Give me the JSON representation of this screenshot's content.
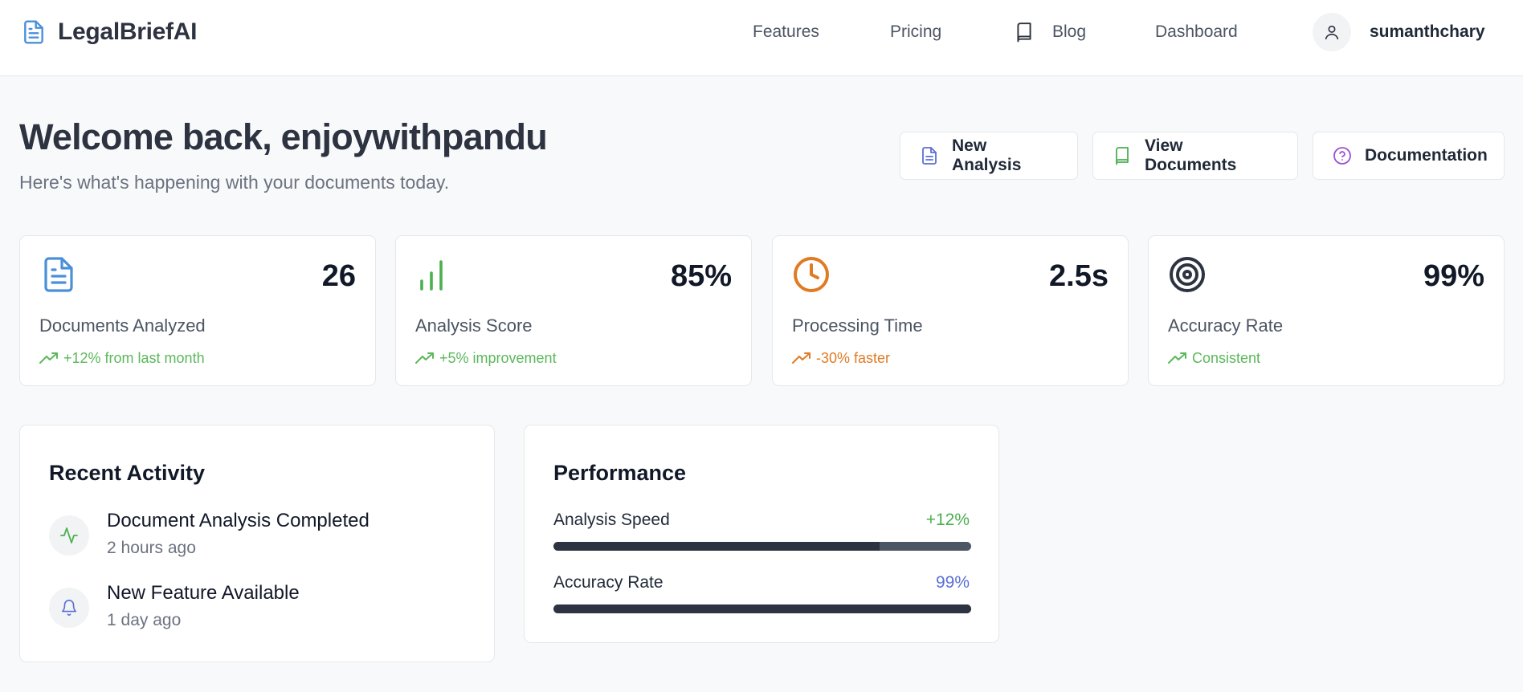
{
  "brand": {
    "name": "LegalBriefAI",
    "icon": "document-icon"
  },
  "nav": {
    "features": "Features",
    "pricing": "Pricing",
    "blog": "Blog",
    "dashboard": "Dashboard",
    "user": "sumanthchary"
  },
  "welcome": {
    "title": "Welcome back, enjoywithpandu",
    "subtitle": "Here's what's happening with your documents today."
  },
  "actions": {
    "new_analysis": "New Analysis",
    "view_documents": "View Documents",
    "documentation": "Documentation"
  },
  "stats": [
    {
      "value": "26",
      "label": "Documents Analyzed",
      "trend": "+12% from last month",
      "icon": "document-icon",
      "color": "#4a90d9",
      "trend_color": "#5cb85c"
    },
    {
      "value": "85%",
      "label": "Analysis Score",
      "trend": "+5% improvement",
      "icon": "bar-chart-icon",
      "color": "#4caf50",
      "trend_color": "#5cb85c"
    },
    {
      "value": "2.5s",
      "label": "Processing Time",
      "trend": "-30% faster",
      "icon": "clock-icon",
      "color": "#e07b24",
      "trend_color": "#e07b24"
    },
    {
      "value": "99%",
      "label": "Accuracy Rate",
      "trend": "Consistent",
      "icon": "target-icon",
      "color": "#2d3340",
      "trend_color": "#5cb85c"
    }
  ],
  "recent_activity": {
    "title": "Recent Activity",
    "items": [
      {
        "title": "Document Analysis Completed",
        "time": "2 hours ago",
        "icon": "activity-icon"
      },
      {
        "title": "New Feature Available",
        "time": "1 day ago",
        "icon": "bell-icon"
      }
    ]
  },
  "performance": {
    "title": "Performance",
    "metrics": [
      {
        "label": "Analysis Speed",
        "value": "+12%",
        "fill": 0.78,
        "color": "#4caf50"
      },
      {
        "label": "Accuracy Rate",
        "value": "99%",
        "fill": 1.0,
        "color": "#5b6fd6"
      }
    ]
  }
}
